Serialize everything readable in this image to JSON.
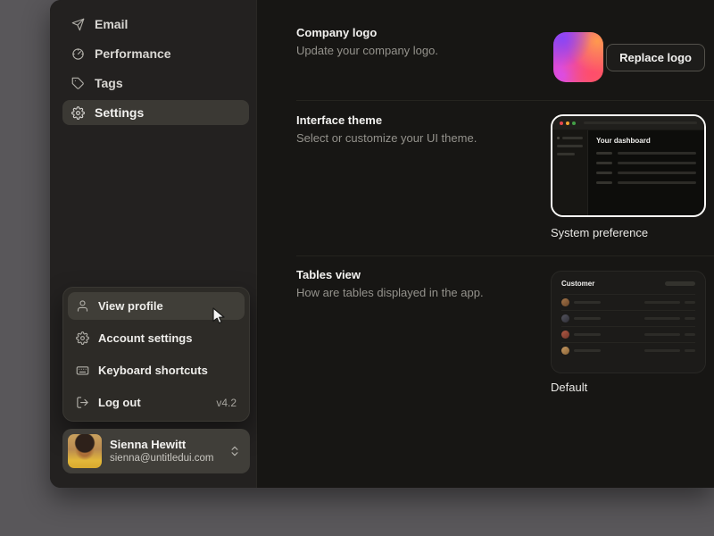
{
  "sidebar": {
    "items": [
      {
        "label": "Email",
        "icon": "send-icon"
      },
      {
        "label": "Performance",
        "icon": "gauge-icon"
      },
      {
        "label": "Tags",
        "icon": "tag-icon"
      },
      {
        "label": "Settings",
        "icon": "gear-icon",
        "active": true
      }
    ],
    "menu": {
      "items": [
        {
          "label": "View profile",
          "icon": "user-icon",
          "highlighted": true
        },
        {
          "label": "Account settings",
          "icon": "gear-icon"
        },
        {
          "label": "Keyboard shortcuts",
          "icon": "keyboard-icon"
        },
        {
          "label": "Log out",
          "icon": "log-out-icon",
          "badge": "v4.2"
        }
      ]
    },
    "user": {
      "name": "Sienna Hewitt",
      "email": "sienna@untitledui.com"
    }
  },
  "main": {
    "sections": [
      {
        "title": "Company logo",
        "description": "Update your company logo.",
        "action_label": "Replace logo"
      },
      {
        "title": "Interface theme",
        "description": "Select or customize your UI theme.",
        "selected_option": "System preference",
        "preview_title": "Your dashboard"
      },
      {
        "title": "Tables view",
        "description": "How are tables displayed in the app.",
        "selected_option": "Default",
        "preview_title": "Customer"
      }
    ]
  },
  "colors": {
    "traffic_red": "#e5484d",
    "traffic_yellow": "#f0a530",
    "traffic_green": "#43a047",
    "logo_gradient": [
      "#8a45f5",
      "#f0458c",
      "#ff6b4d",
      "#ff9a4d"
    ],
    "sidebar_bg": "#232120",
    "content_bg": "#171614"
  }
}
